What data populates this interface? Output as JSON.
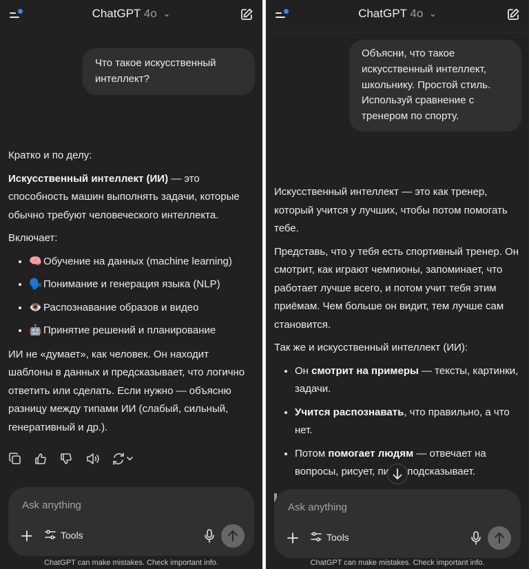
{
  "left": {
    "header": {
      "title": "ChatGPT",
      "version": "4o"
    },
    "user_message": "Что такое искусственный интеллект?",
    "answer": {
      "intro": "Кратко и по делу:",
      "definition_bold": "Искусственный интеллект (ИИ)",
      "definition_rest": " — это способность машин выполнять задачи, которые обычно требуют человеческого интеллекта.",
      "includes_label": "Включает:",
      "items": [
        {
          "emoji": "🧠",
          "text": "Обучение на данных (machine learning)"
        },
        {
          "emoji": "🗣️",
          "text": "Понимание и генерация языка (NLP)"
        },
        {
          "emoji": "👁️",
          "text": "Распознавание образов и видео"
        },
        {
          "emoji": "🤖",
          "text": "Принятие решений и планирование"
        }
      ],
      "closing": "ИИ не «думает», как человек. Он находит шаблоны в данных и предсказывает, что логично ответить или сделать. Если нужно — объясню разницу между типами ИИ (слабый, сильный, генеративный и др.)."
    },
    "actions": [
      "copy-icon",
      "thumbs-up-icon",
      "thumbs-down-icon",
      "read-aloud-icon",
      "regenerate-icon"
    ],
    "composer": {
      "placeholder": "Ask anything",
      "tools_label": "Tools"
    },
    "footer": "ChatGPT can make mistakes. Check important info."
  },
  "right": {
    "header": {
      "title": "ChatGPT",
      "version": "4o"
    },
    "user_message": "Объясни, что такое искусственный интеллект, школьнику. Простой стиль. Используй сравнение с тренером по спорту.",
    "answer": {
      "p1": "Искусственный интеллект — это как тренер, который учится у лучших, чтобы потом помогать тебе.",
      "p2": "Представь, что у тебя есть спортивный тренер. Он смотрит, как играют чемпионы, запоминает, что работает лучше всего, и потом учит тебя этим приёмам. Чем больше он видит, тем лучше сам становится.",
      "p3": "Так же и искусственный интеллект (ИИ):",
      "items": [
        {
          "pre": "Он ",
          "bold": "смотрит на примеры",
          "post": " — тексты, картинки, задачи."
        },
        {
          "pre": "",
          "bold": "Учится распознавать",
          "post": ", что правильно, а что нет."
        },
        {
          "pre": "Потом ",
          "bold": "помогает людям",
          "post": " — отвечает на вопросы, рисует, пи",
          "post2": ", подсказывает."
        }
      ]
    },
    "composer": {
      "placeholder": "Ask anything",
      "tools_label": "Tools"
    },
    "footer": "ChatGPT can make mistakes. Check important info."
  },
  "colors": {
    "background": "#212121",
    "bubble": "#303030",
    "accent_dot": "#3b82f6",
    "send_button": "#676767"
  }
}
